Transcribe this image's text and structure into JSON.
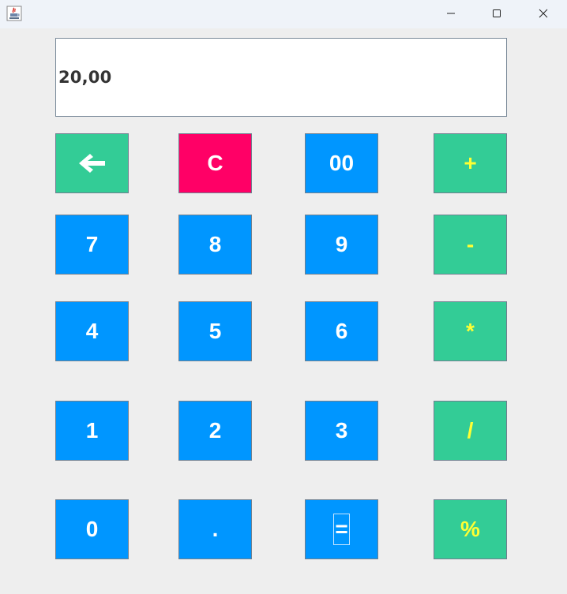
{
  "window": {
    "app_icon": "java-cup-icon",
    "controls": {
      "minimize_icon": "minimize-icon",
      "maximize_icon": "maximize-icon",
      "close_icon": "close-icon"
    }
  },
  "display": {
    "value": "20,00"
  },
  "keys": {
    "backspace": {
      "icon": "backspace-arrow-icon",
      "color": "#33cc96"
    },
    "clear": {
      "label": "C",
      "color": "#ff0066"
    },
    "double_zero": {
      "label": "00",
      "color": "#0096ff"
    },
    "plus": {
      "label": "+",
      "color": "#33cc96"
    },
    "seven": {
      "label": "7"
    },
    "eight": {
      "label": "8"
    },
    "nine": {
      "label": "9"
    },
    "minus": {
      "label": "-"
    },
    "four": {
      "label": "4"
    },
    "five": {
      "label": "5"
    },
    "six": {
      "label": "6"
    },
    "multiply": {
      "label": "*"
    },
    "one": {
      "label": "1"
    },
    "two": {
      "label": "2"
    },
    "three": {
      "label": "3"
    },
    "divide": {
      "label": "/"
    },
    "zero": {
      "label": "0"
    },
    "decimal": {
      "label": "."
    },
    "equals": {
      "label": "="
    },
    "percent": {
      "label": "%"
    }
  },
  "colors": {
    "digit_blue": "#0096ff",
    "operator_green": "#33cc96",
    "clear_red": "#ff0066",
    "operator_text_yellow": "#ffff33"
  }
}
